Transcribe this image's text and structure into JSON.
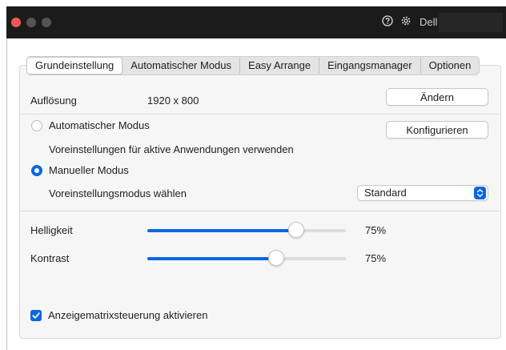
{
  "titlebar": {
    "brand": "Dell",
    "help_icon": "help-circle-icon",
    "settings_icon": "gear-icon"
  },
  "tabs": [
    {
      "label": "Grundeinstellung",
      "active": true
    },
    {
      "label": "Automatischer Modus",
      "active": false
    },
    {
      "label": "Easy Arrange",
      "active": false
    },
    {
      "label": "Eingangsmanager",
      "active": false
    },
    {
      "label": "Optionen",
      "active": false
    }
  ],
  "resolution": {
    "label": "Auflösung",
    "value": "1920 x 800",
    "change_button": "Ändern"
  },
  "modes": {
    "auto_label": "Automatischer Modus",
    "auto_selected": false,
    "configure_button": "Konfigurieren",
    "auto_description": "Voreinstellungen für aktive Anwendungen verwenden",
    "manual_label": "Manueller Modus",
    "manual_selected": true,
    "preset_label": "Voreinstellungsmodus wählen",
    "preset_value": "Standard"
  },
  "sliders": {
    "brightness": {
      "label": "Helligkeit",
      "value_text": "75%",
      "level": 0.75
    },
    "contrast": {
      "label": "Kontrast",
      "value_text": "75%",
      "level": 0.65
    }
  },
  "matrix": {
    "label": "Anzeigematrixsteuerung aktivieren",
    "checked": true
  },
  "colors": {
    "accent": "#0a67e0",
    "titlebar": "#1b1b1b",
    "close": "#ee5a52"
  }
}
